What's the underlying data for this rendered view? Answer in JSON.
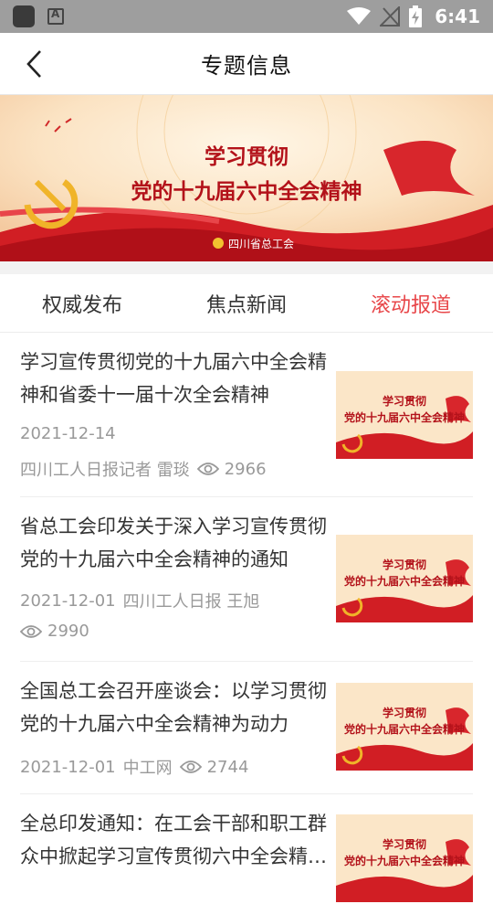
{
  "status_bar": {
    "time": "6:41"
  },
  "nav": {
    "title": "专题信息"
  },
  "banner": {
    "title_line1": "学习贯彻",
    "title_line2": "党的十九届六中全会精神",
    "org": "四川省总工会"
  },
  "thumb": {
    "title_line1": "学习贯彻",
    "title_line2": "党的十九届六中全会精神"
  },
  "tabs": [
    {
      "label": "权威发布",
      "active": false
    },
    {
      "label": "焦点新闻",
      "active": false
    },
    {
      "label": "滚动报道",
      "active": true
    }
  ],
  "news": [
    {
      "title": "学习宣传贯彻党的十九届六中全会精神和省委十一届十次全会精神",
      "date": "2021-12-14",
      "source": "四川工人日报记者 雷琰",
      "views": "2966"
    },
    {
      "title": "省总工会印发关于深入学习宣传贯彻党的十九届六中全会精神的通知",
      "date": "2021-12-01",
      "source": "四川工人日报 王旭",
      "views": "2990"
    },
    {
      "title": "全国总工会召开座谈会：以学习贯彻党的十九届六中全会精神为动力",
      "date": "2021-12-01",
      "source": "中工网",
      "views": "2744"
    },
    {
      "title": "全总印发通知：在工会干部和职工群众中掀起学习宣传贯彻六中全会精神热潮",
      "date": "",
      "source": "",
      "views": ""
    }
  ]
}
